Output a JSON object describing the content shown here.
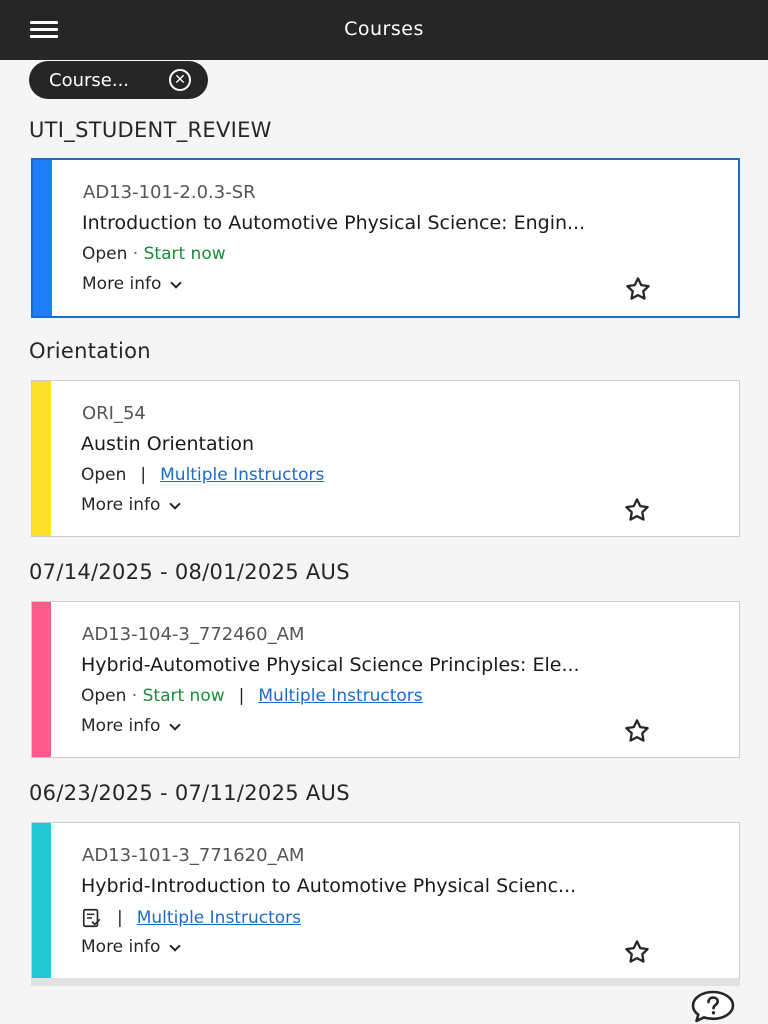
{
  "header": {
    "title": "Courses"
  },
  "filter": {
    "label": "Course..."
  },
  "sections": [
    {
      "title": "UTI_STUDENT_REVIEW",
      "course": {
        "code": "AD13-101-2.0.3-SR",
        "name": "Introduction to Automotive Physical Science: Engin...",
        "status": "Open",
        "start_label": "Start now",
        "more_info": "More info",
        "color": "#1e7ef7"
      }
    },
    {
      "title": "Orientation",
      "course": {
        "code": "ORI_54",
        "name": "Austin Orientation",
        "status": "Open",
        "instructors": "Multiple Instructors",
        "more_info": "More info",
        "color": "#fde02a"
      }
    },
    {
      "title": "07/14/2025 - 08/01/2025 AUS",
      "course": {
        "code": "AD13-104-3_772460_AM",
        "name": "Hybrid-Automotive Physical Science Principles: Ele...",
        "status": "Open",
        "start_label": "Start now",
        "instructors": "Multiple Instructors",
        "more_info": "More info",
        "color": "#ff5a8c"
      }
    },
    {
      "title": "06/23/2025 - 07/11/2025 AUS",
      "course": {
        "code": "AD13-101-3_771620_AM",
        "name": "Hybrid-Introduction to Automotive Physical Scienc...",
        "instructors": "Multiple Instructors",
        "more_info": "More info",
        "color": "#23c8d2",
        "status_icon": "completed-doc-icon"
      }
    }
  ],
  "icons": {
    "menu": "hamburger-menu-icon",
    "clear_filter": "close-circle-icon",
    "favorite": "star-outline-icon",
    "expand": "chevron-down-icon",
    "help": "help-bubble-icon"
  }
}
